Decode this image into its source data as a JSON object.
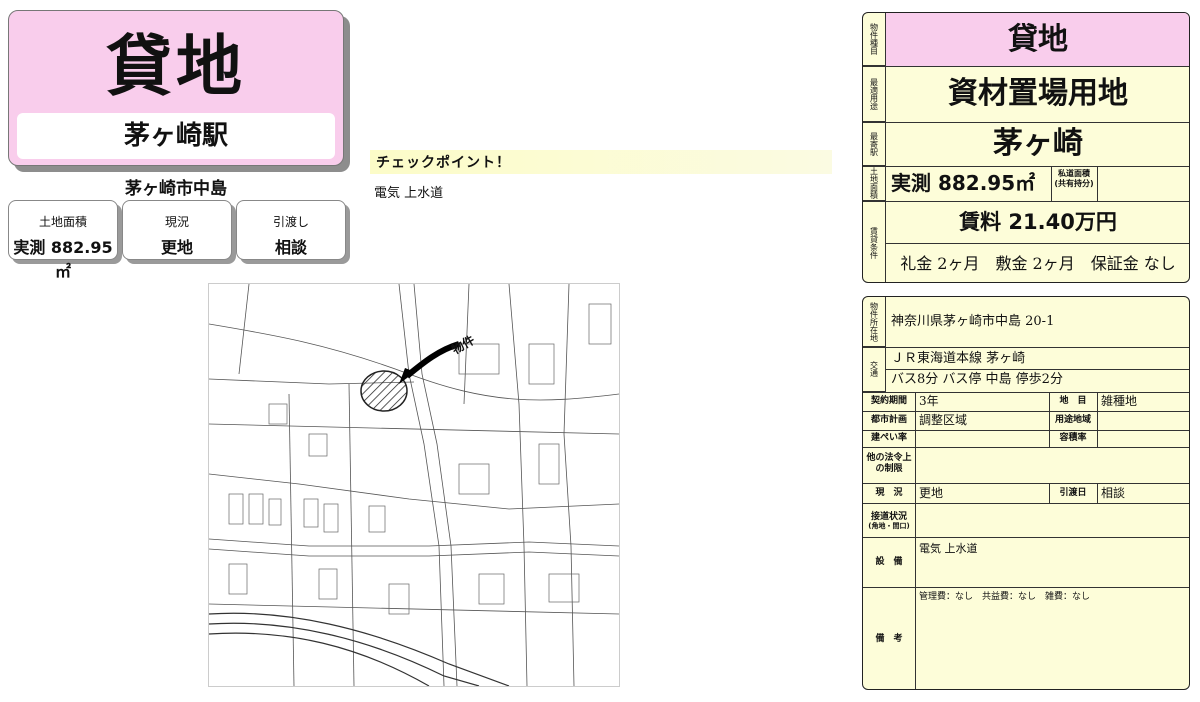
{
  "title": {
    "main": "貸地",
    "station": "茅ヶ崎駅"
  },
  "address_short": "茅ヶ崎市中島",
  "summary_cards": [
    {
      "label": "土地面積",
      "value": "実測 882.95㎡"
    },
    {
      "label": "現況",
      "value": "更地"
    },
    {
      "label": "引渡し",
      "value": "相談"
    }
  ],
  "checkpoint": {
    "title": "チェックポイント！",
    "text": "電気 上水道"
  },
  "map": {
    "annotation": "物件"
  },
  "spec": {
    "type_label": "物件種目",
    "type_value": "貸地",
    "use_label": "最適用途",
    "use_value": "資材置場用地",
    "station_label": "最寄駅",
    "station_value": "茅ヶ崎",
    "area_label": "土地面積",
    "area_value": "実測 882.95㎡",
    "private_road_label": "私道面積\n(共有持分)",
    "private_road_value": "",
    "rent_label": "賃貸条件",
    "rent_value": "賃料 21.40万円",
    "fees": "礼金 2ヶ月　敷金 2ヶ月　保証金 なし"
  },
  "details": {
    "location_label": "物件所在地",
    "location_value": "神奈川県茅ヶ崎市中島 20-1",
    "transport_label": "交通",
    "transport_line1": "ＪＲ東海道本線 茅ヶ崎",
    "transport_line2": "バス8分 バス停 中島 停歩2分",
    "contract_label": "契約期間",
    "contract_value": "3年",
    "land_cat_label": "地　目",
    "land_cat_value": "雑種地",
    "city_plan_label": "都市計画",
    "city_plan_value": "調整区域",
    "zoning_label": "用途地域",
    "zoning_value": "",
    "coverage_label": "建ぺい率",
    "coverage_value": "",
    "far_label": "容積率",
    "far_value": "",
    "other_law_label": "他の法令上の制限",
    "other_law_value": "",
    "status_label": "現　況",
    "status_value": "更地",
    "handover_label": "引渡日",
    "handover_value": "相談",
    "road_label": "接道状況",
    "road_sub": "(角地・間口)",
    "road_value": "",
    "facility_label": "設　備",
    "facility_value": "電気 上水道",
    "notes_label": "備　考",
    "notes_value": "管理費：なし　共益費：なし　雑費：なし"
  }
}
